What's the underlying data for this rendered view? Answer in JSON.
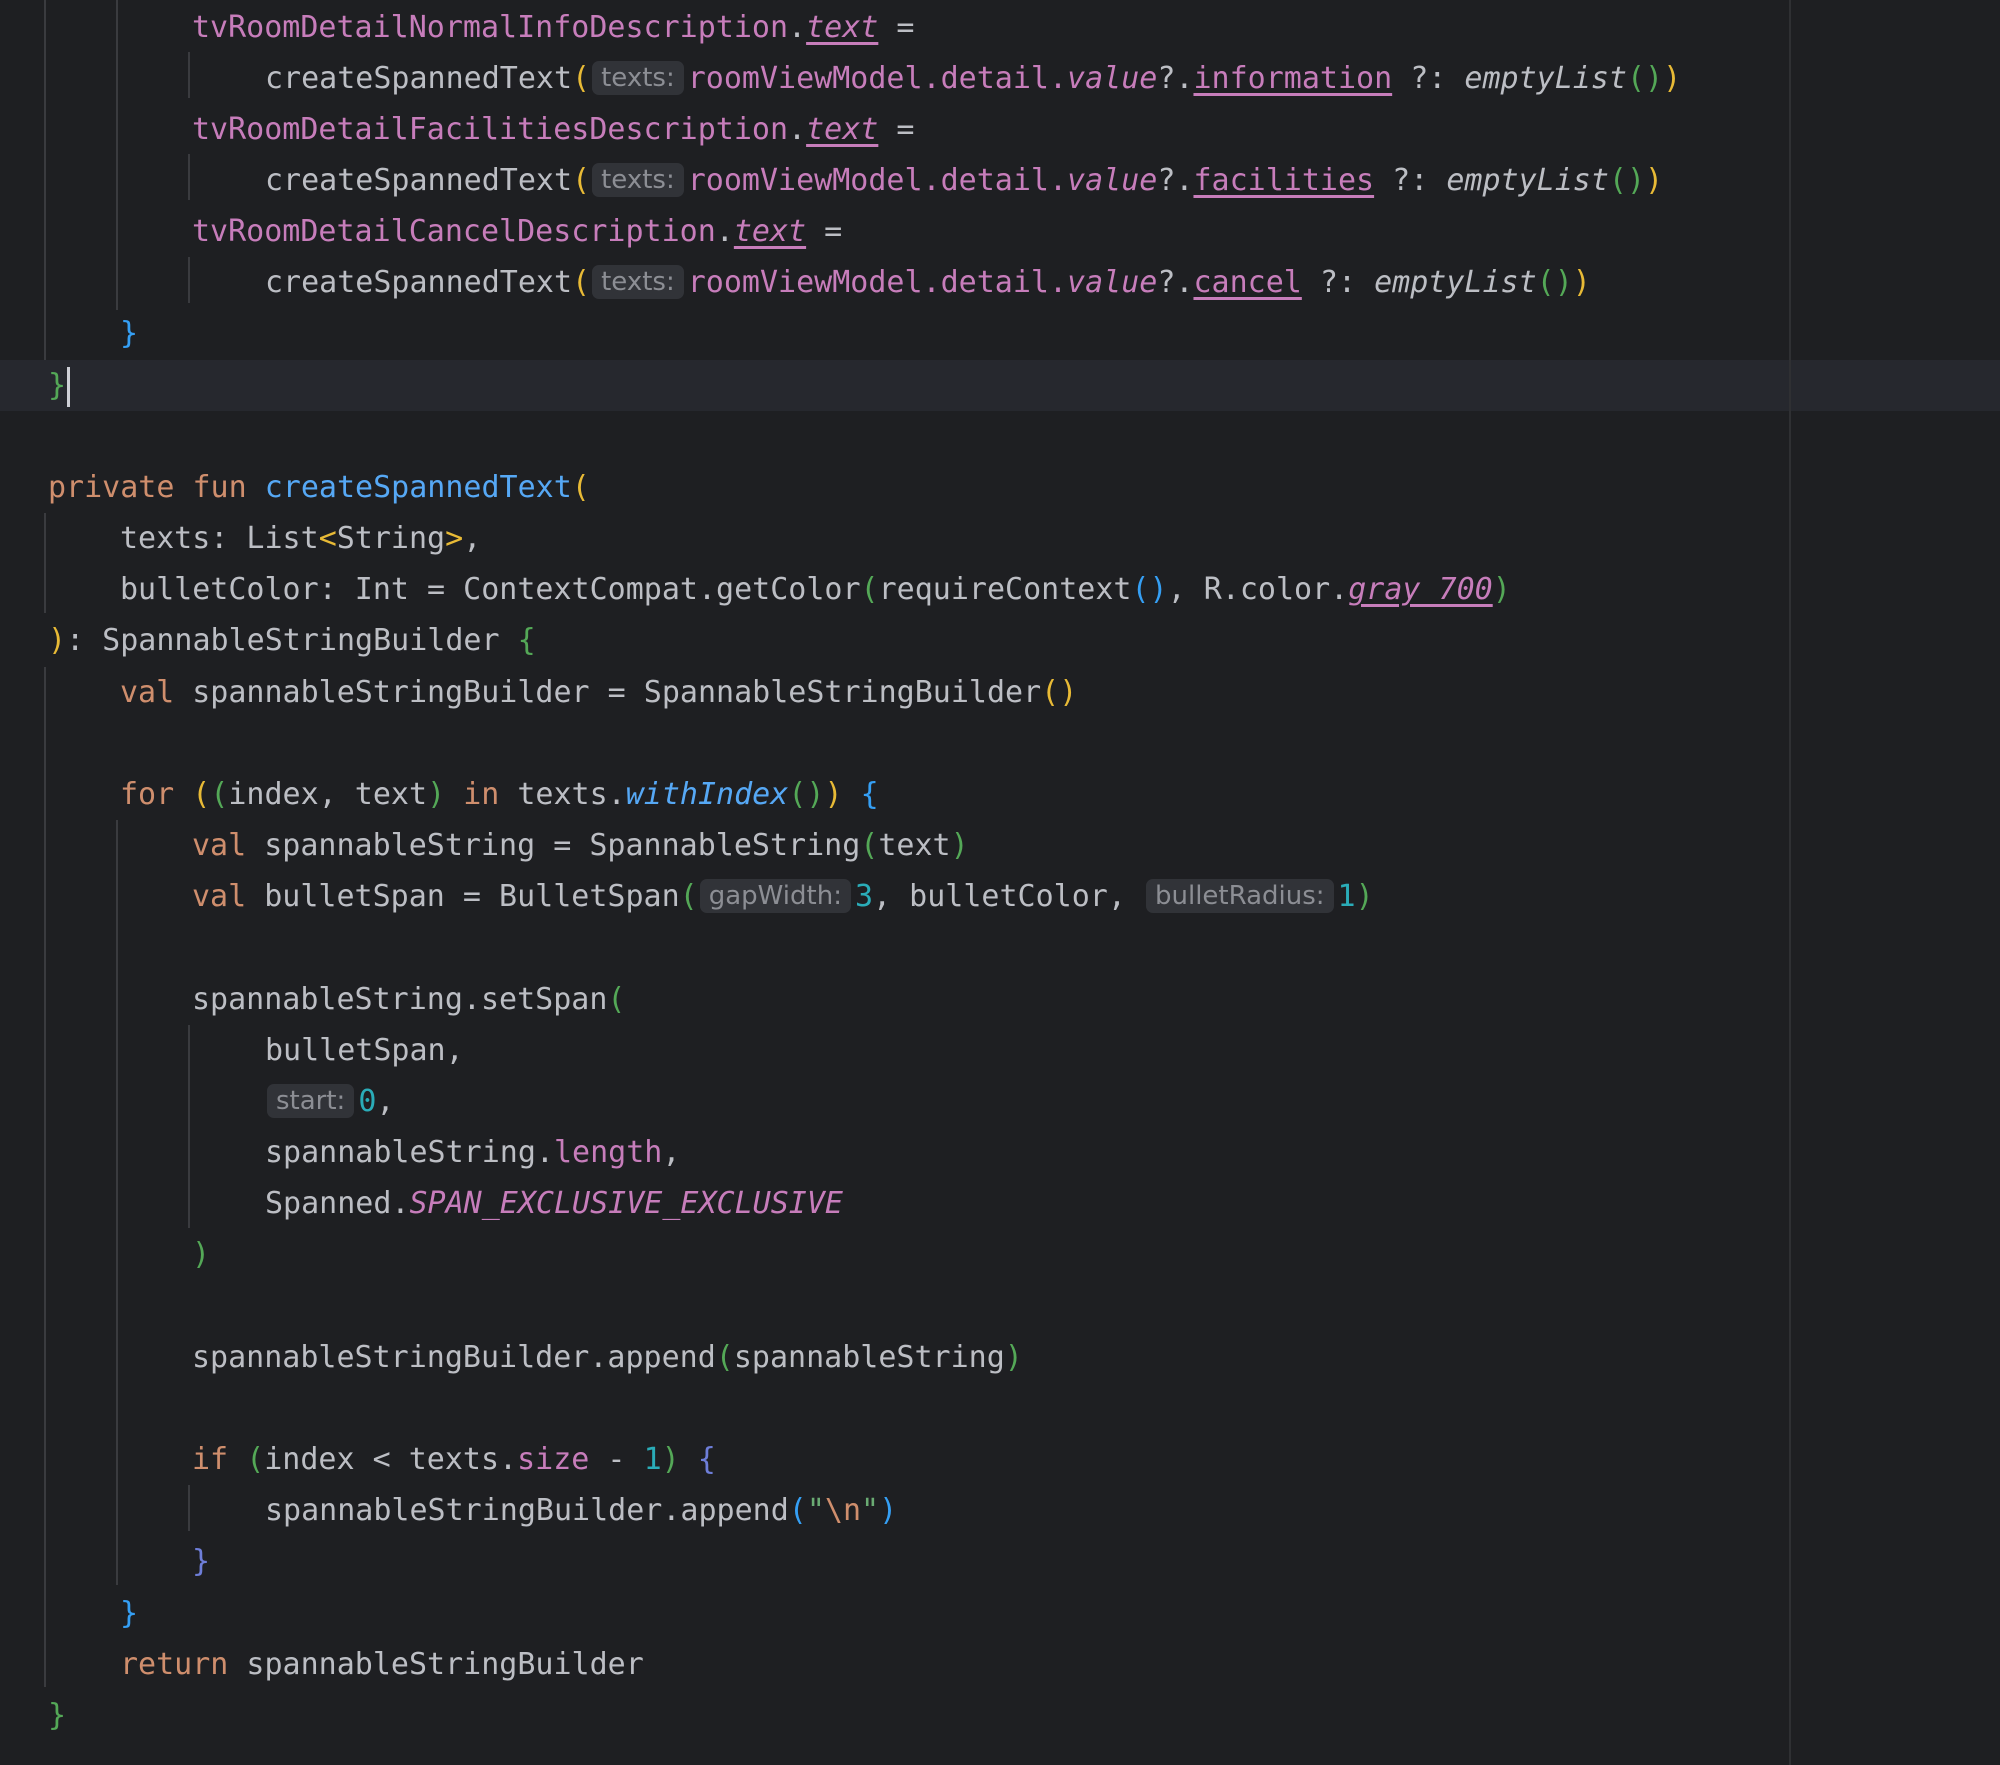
{
  "editor": {
    "lines": {
      "l01": {
        "t1": "tvRoomDetailNormalInfoDescription",
        "t2": ".",
        "t3": "text",
        "t4": " ="
      },
      "l02": {
        "t1": "createSpannedText",
        "t2": "(",
        "h1": "texts:",
        "t3": "roomViewModel.detail.",
        "t4": "value",
        "t5": "?.",
        "t6": "information",
        "t7": " ?: ",
        "t8": "emptyList",
        "t9": "()",
        "t10": ")"
      },
      "l03": {
        "t1": "tvRoomDetailFacilitiesDescription",
        "t2": ".",
        "t3": "text",
        "t4": " ="
      },
      "l04": {
        "t1": "createSpannedText",
        "t2": "(",
        "h1": "texts:",
        "t3": "roomViewModel.detail.",
        "t4": "value",
        "t5": "?.",
        "t6": "facilities",
        "t7": " ?: ",
        "t8": "emptyList",
        "t9": "()",
        "t10": ")"
      },
      "l05": {
        "t1": "tvRoomDetailCancelDescription",
        "t2": ".",
        "t3": "text",
        "t4": " ="
      },
      "l06": {
        "t1": "createSpannedText",
        "t2": "(",
        "h1": "texts:",
        "t3": "roomViewModel.detail.",
        "t4": "value",
        "t5": "?.",
        "t6": "cancel",
        "t7": " ?: ",
        "t8": "emptyList",
        "t9": "()",
        "t10": ")"
      },
      "l07": {
        "t1": "}"
      },
      "l08": {
        "t1": "}"
      },
      "l09": {
        "t1": "private",
        "t2": " ",
        "t3": "fun",
        "t4": " ",
        "t5": "createSpannedText",
        "t6": "("
      },
      "l10": {
        "t1": "texts: List",
        "t2": "<",
        "t3": "String",
        "t4": ">",
        "t5": ","
      },
      "l11": {
        "t1": "bulletColor: Int = ContextCompat.getColor",
        "t2": "(",
        "t3": "requireContext",
        "t4": "()",
        "t5": ", R.color.",
        "t6": "gray_700",
        "t7": ")"
      },
      "l12": {
        "t1": ")",
        "t2": ": SpannableStringBuilder ",
        "t3": "{"
      },
      "l13": {
        "t1": "val",
        "t2": " spannableStringBuilder = SpannableStringBuilder",
        "t3": "()"
      },
      "l14": {
        "t1": "for",
        "t2": " ",
        "t3": "(",
        "t4": "(",
        "t5": "index, text",
        "t6": ")",
        "t7": " ",
        "t8": "in",
        "t9": " texts.",
        "t10": "withIndex",
        "t11": "()",
        "t12": ")",
        "t13": " ",
        "t14": "{"
      },
      "l15": {
        "t1": "val",
        "t2": " spannableString = SpannableString",
        "t3": "(",
        "t4": "text",
        "t5": ")"
      },
      "l16": {
        "t1": "val",
        "t2": " bulletSpan = BulletSpan",
        "t3": "(",
        "h1": "gapWidth:",
        "t4": "3",
        "t5": ", bulletColor, ",
        "h2": "bulletRadius:",
        "t6": "1",
        "t7": ")"
      },
      "l17": {
        "t1": "spannableString.setSpan",
        "t2": "("
      },
      "l18": {
        "t1": "bulletSpan,"
      },
      "l19": {
        "h1": "start:",
        "t1": "0",
        "t2": ","
      },
      "l20": {
        "t1": "spannableString.",
        "t2": "length",
        "t3": ","
      },
      "l21": {
        "t1": "Spanned.",
        "t2": "SPAN_EXCLUSIVE_EXCLUSIVE"
      },
      "l22": {
        "t1": ")"
      },
      "l23": {
        "t1": "spannableStringBuilder.append",
        "t2": "(",
        "t3": "spannableString",
        "t4": ")"
      },
      "l24": {
        "t1": "if",
        "t2": " ",
        "t3": "(",
        "t4": "index < texts.",
        "t5": "size",
        "t6": " - ",
        "t7": "1",
        "t8": ")",
        "t9": " ",
        "t10": "{"
      },
      "l25": {
        "t1": "spannableStringBuilder.append",
        "t2": "(",
        "t3": "\"",
        "t4": "\\n",
        "t5": "\"",
        "t6": ")"
      },
      "l26": {
        "t1": "}"
      },
      "l27": {
        "t1": "}"
      },
      "l28": {
        "t1": "return",
        "t2": " spannableStringBuilder"
      },
      "l29": {
        "t1": "}"
      }
    }
  }
}
